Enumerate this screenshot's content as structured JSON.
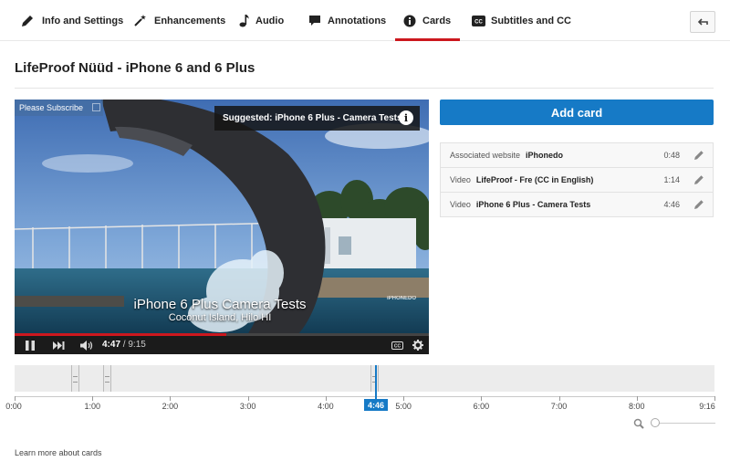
{
  "tabs": [
    {
      "label": "Info and Settings",
      "icon": "pencil-icon"
    },
    {
      "label": "Enhancements",
      "icon": "magic-wand-icon"
    },
    {
      "label": "Audio",
      "icon": "music-note-icon"
    },
    {
      "label": "Annotations",
      "icon": "speech-bubble-icon"
    },
    {
      "label": "Cards",
      "icon": "info-icon",
      "active": true
    },
    {
      "label": "Subtitles and CC",
      "icon": "cc-icon"
    }
  ],
  "video_title": "LifeProof Nüüd - iPhone 6 and 6 Plus",
  "player": {
    "subscribe_label": "Please Subscribe",
    "suggested_text": "Suggested: iPhone 6 Plus - Camera Tests",
    "overlay_line1": "iPhone 6 Plus Camera Tests",
    "overlay_line2": "Coconut Island, Hilo HI",
    "watermark": "iPHONEDO",
    "current_time": "4:47",
    "duration": "/ 9:15",
    "progress_fraction": 0.51
  },
  "add_card_label": "Add card",
  "cards": [
    {
      "type": "Associated website",
      "name": "iPhonedo",
      "time": "0:48"
    },
    {
      "type": "Video",
      "name": "LifeProof - Fre (CC in English)",
      "time": "1:14"
    },
    {
      "type": "Video",
      "name": "iPhone 6 Plus - Camera Tests",
      "time": "4:46"
    }
  ],
  "timeline": {
    "ticks": [
      "0:00",
      "1:00",
      "2:00",
      "3:00",
      "4:00",
      "5:00",
      "6:00",
      "7:00",
      "8:00",
      "9:16"
    ],
    "current_label": "4:46"
  },
  "learn_more": "Learn more about cards",
  "colors": {
    "accent": "#167ac6",
    "active_tab": "#cc181e"
  }
}
